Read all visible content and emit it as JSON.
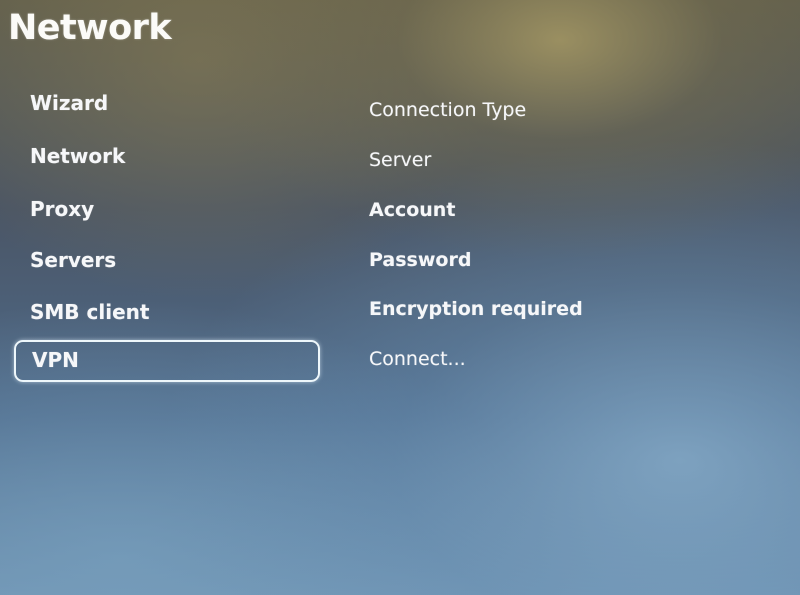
{
  "header": {
    "title": "Network"
  },
  "menu": {
    "items": [
      {
        "label": "Wizard"
      },
      {
        "label": "Network"
      },
      {
        "label": "Proxy"
      },
      {
        "label": "Servers"
      },
      {
        "label": "SMB client"
      },
      {
        "label": "VPN",
        "selected": true
      }
    ]
  },
  "vpn_settings": {
    "items": [
      {
        "label": "Connection Type"
      },
      {
        "label": "Server"
      },
      {
        "label": "Account"
      },
      {
        "label": "Password"
      },
      {
        "label": "Encryption required"
      },
      {
        "label": "Connect..."
      }
    ]
  }
}
